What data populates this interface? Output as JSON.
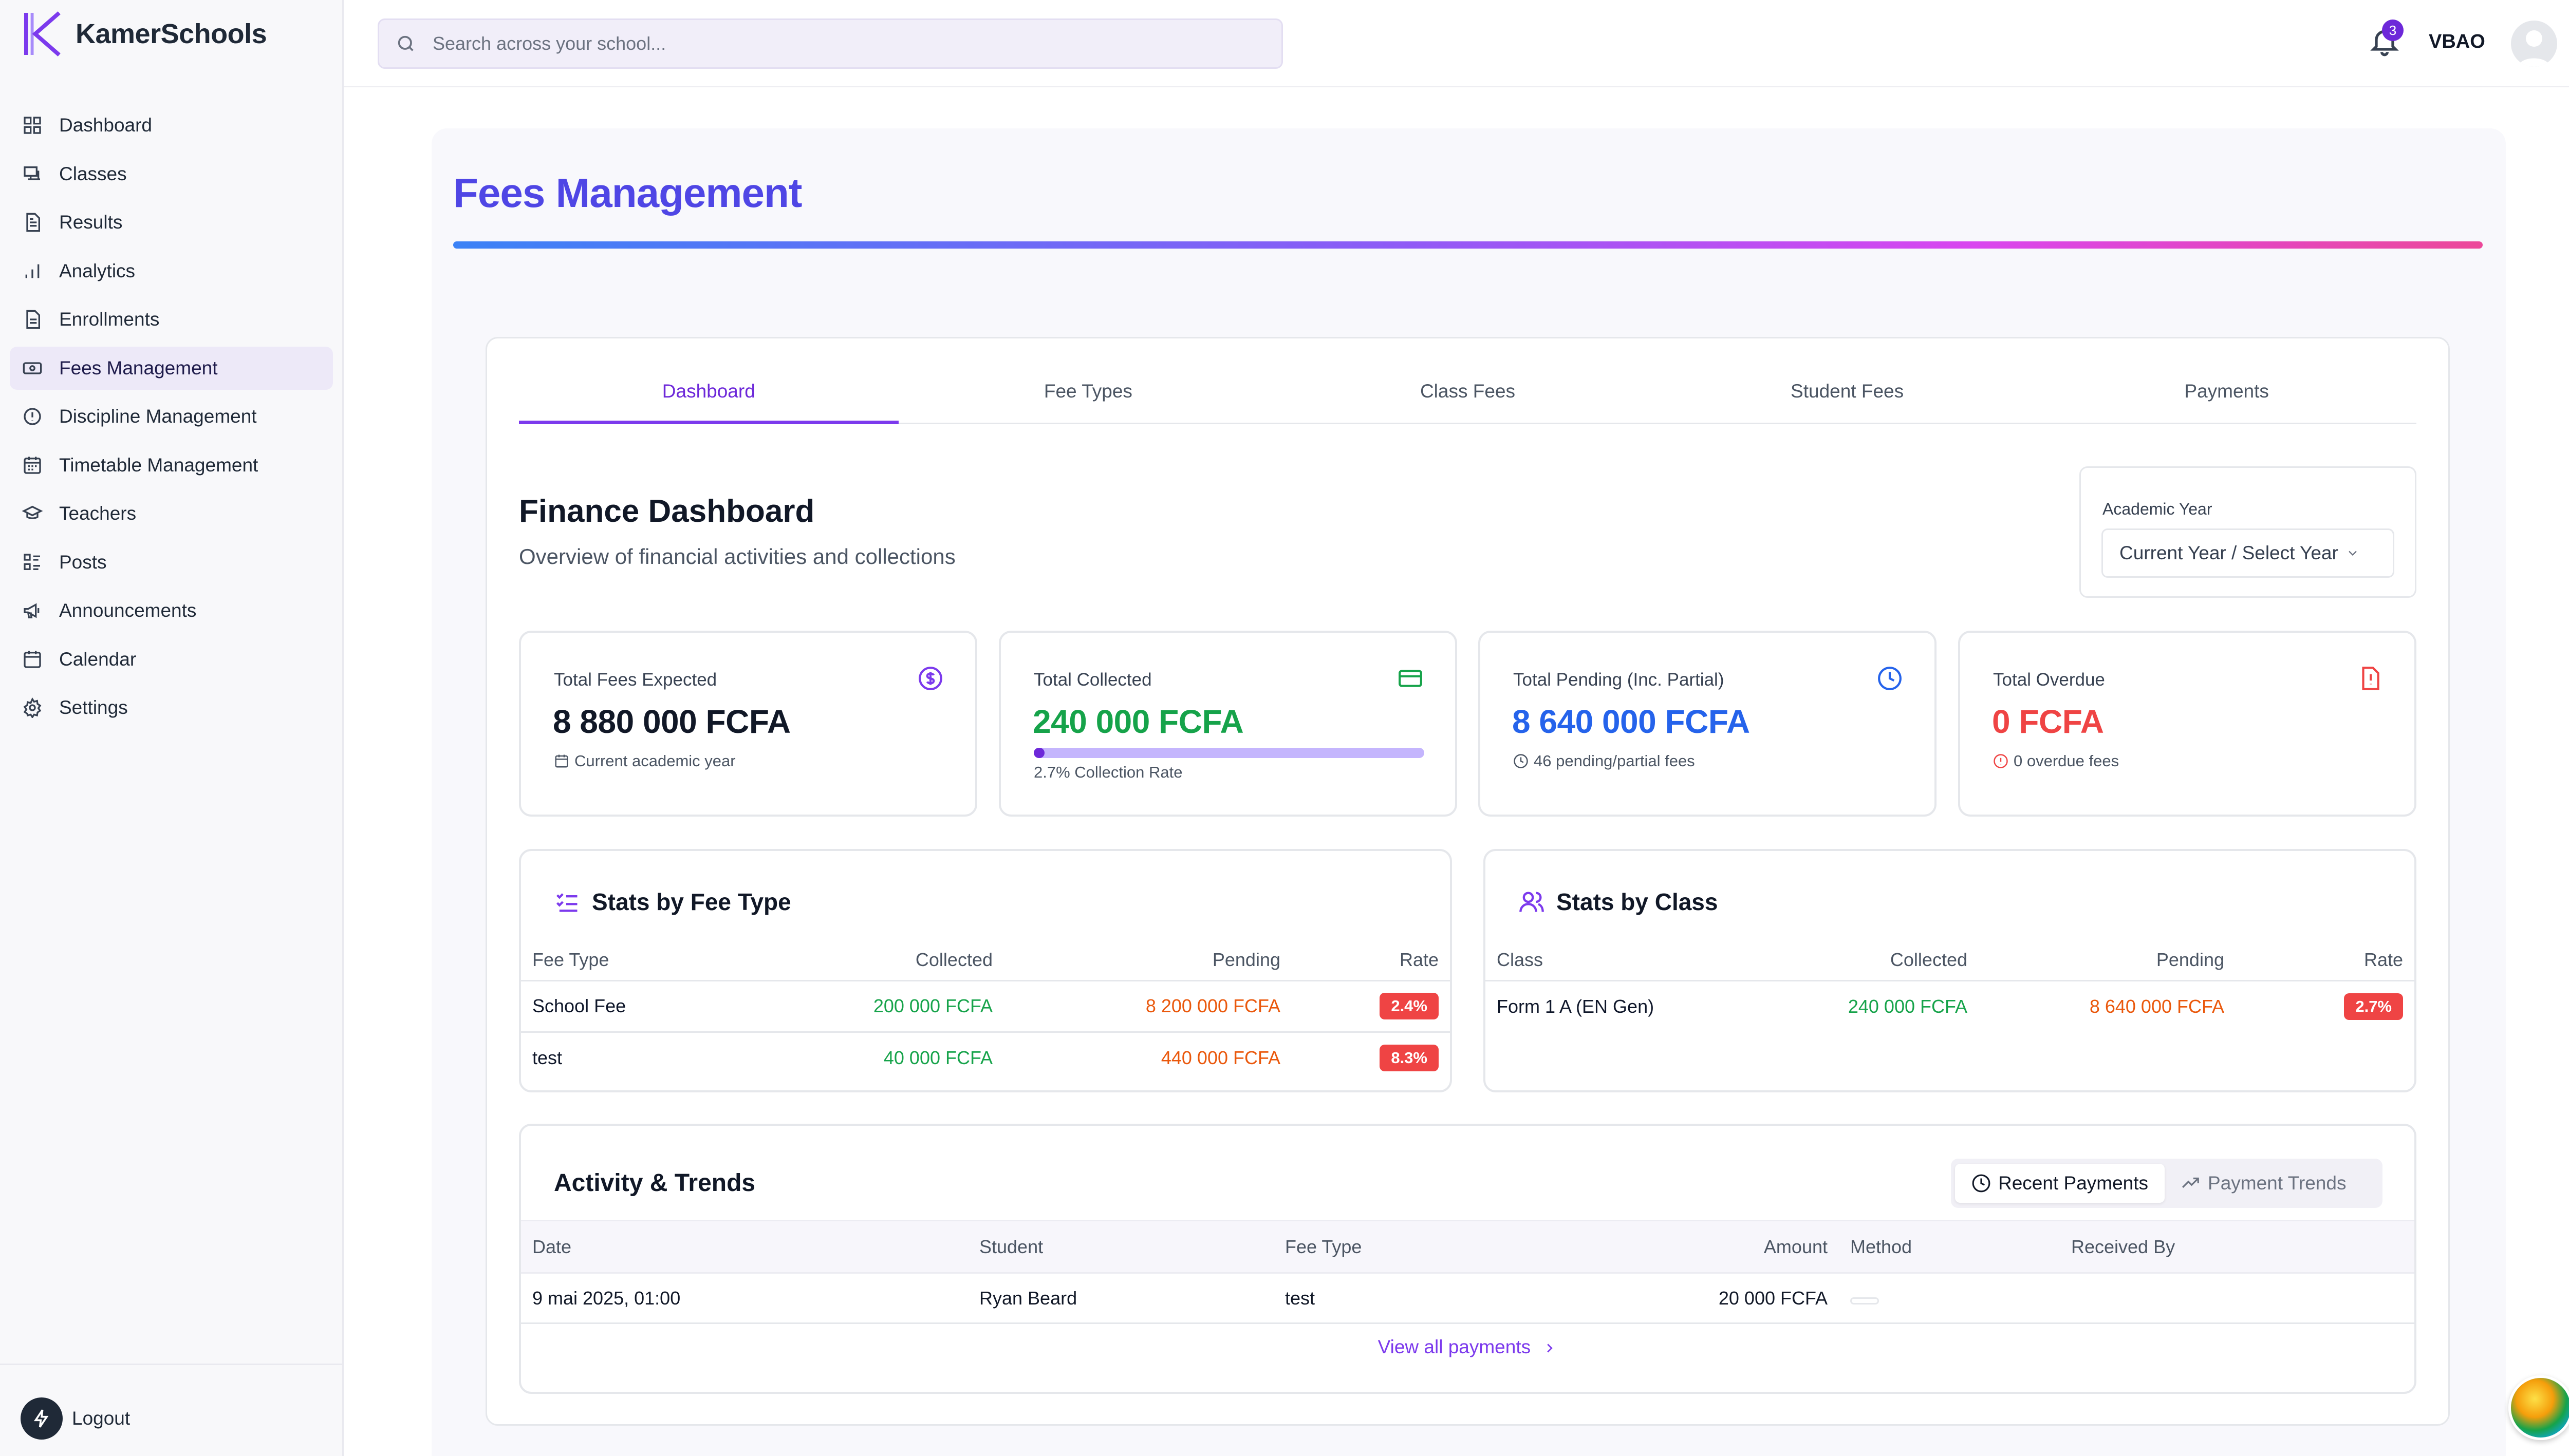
{
  "app": {
    "name": "KamerSchools"
  },
  "sidebar": {
    "items": [
      {
        "label": "Dashboard",
        "icon": "dashboard-icon"
      },
      {
        "label": "Classes",
        "icon": "classes-icon"
      },
      {
        "label": "Results",
        "icon": "results-icon"
      },
      {
        "label": "Analytics",
        "icon": "analytics-icon"
      },
      {
        "label": "Enrollments",
        "icon": "enrollments-icon"
      },
      {
        "label": "Fees Management",
        "icon": "fees-icon",
        "active": true
      },
      {
        "label": "Discipline Management",
        "icon": "discipline-icon"
      },
      {
        "label": "Timetable Management",
        "icon": "timetable-icon"
      },
      {
        "label": "Teachers",
        "icon": "teachers-icon"
      },
      {
        "label": "Posts",
        "icon": "posts-icon"
      },
      {
        "label": "Announcements",
        "icon": "announcements-icon"
      },
      {
        "label": "Calendar",
        "icon": "calendar-icon"
      },
      {
        "label": "Settings",
        "icon": "settings-icon"
      }
    ],
    "logout_label": "Logout"
  },
  "header": {
    "search_placeholder": "Search across your school...",
    "notification_count": "3",
    "username": "VBAO"
  },
  "page": {
    "title": "Fees Management",
    "tabs": [
      "Dashboard",
      "Fee Types",
      "Class Fees",
      "Student Fees",
      "Payments"
    ],
    "active_tab": "Dashboard"
  },
  "dashboard": {
    "title": "Finance Dashboard",
    "subtitle": "Overview of financial activities and collections",
    "academic_year_label": "Academic Year",
    "academic_year_value": "Current Year / Select Year"
  },
  "stats": {
    "expected": {
      "label": "Total Fees Expected",
      "value": "8 880 000 FCFA",
      "note": "Current academic year",
      "color": "#111827"
    },
    "collected": {
      "label": "Total Collected",
      "value": "240 000 FCFA",
      "rate_fraction": 0.027,
      "note": "2.7% Collection Rate",
      "color": "#16a34a"
    },
    "pending": {
      "label": "Total Pending (Inc. Partial)",
      "value": "8 640 000 FCFA",
      "note": "46 pending/partial fees",
      "color": "#2563eb"
    },
    "overdue": {
      "label": "Total Overdue",
      "value": "0 FCFA",
      "note": "0 overdue fees",
      "color": "#ef4444"
    }
  },
  "fee_type_stats": {
    "title": "Stats by Fee Type",
    "columns": [
      "Fee Type",
      "Collected",
      "Pending",
      "Rate"
    ],
    "rows": [
      {
        "name": "School Fee",
        "collected": "200 000 FCFA",
        "pending": "8 200 000 FCFA",
        "rate": "2.4%"
      },
      {
        "name": "test",
        "collected": "40 000 FCFA",
        "pending": "440 000 FCFA",
        "rate": "8.3%"
      }
    ]
  },
  "class_stats": {
    "title": "Stats by Class",
    "columns": [
      "Class",
      "Collected",
      "Pending",
      "Rate"
    ],
    "rows": [
      {
        "name": "Form 1 A (EN Gen)",
        "collected": "240 000 FCFA",
        "pending": "8 640 000 FCFA",
        "rate": "2.7%"
      }
    ]
  },
  "activity": {
    "title": "Activity & Trends",
    "toggle": {
      "recent": "Recent Payments",
      "trends": "Payment Trends"
    },
    "columns": [
      "Date",
      "Student",
      "Fee Type",
      "Amount",
      "Method",
      "Received By"
    ],
    "rows": [
      {
        "date": "9 mai 2025, 01:00",
        "student": "Ryan Beard",
        "fee_type": "test",
        "amount": "20 000 FCFA",
        "method": "",
        "received_by": ""
      }
    ],
    "view_all": "View all payments"
  },
  "colors": {
    "accent": "#7c3aed",
    "title": "#4f46e5",
    "danger": "#ef4444",
    "success": "#16a34a",
    "warning": "#ea580c",
    "info": "#2563eb"
  }
}
